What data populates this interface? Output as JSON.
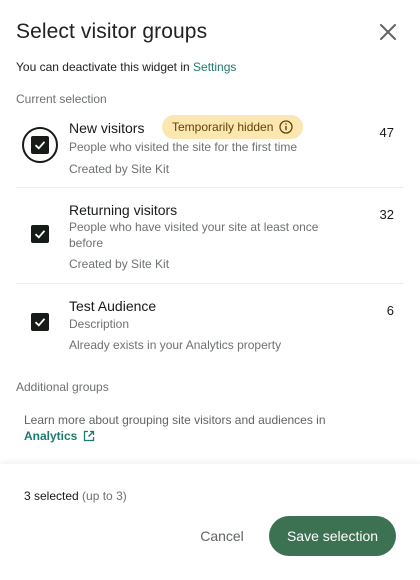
{
  "dialog": {
    "title": "Select visitor groups",
    "subtitle_text": "You can deactivate this widget in",
    "settings_link": "Settings"
  },
  "sections": {
    "current": "Current selection",
    "additional": "Additional groups"
  },
  "groups": [
    {
      "name": "New visitors",
      "badge": "Temporarily hidden",
      "description": "People who visited the site for the first time",
      "meta": "Created by Site Kit",
      "count": "47",
      "checked": true
    },
    {
      "name": "Returning visitors",
      "description": "People who have visited your site at least once before",
      "meta": "Created by Site Kit",
      "count": "32",
      "checked": true
    },
    {
      "name": "Test Audience",
      "description": "Description",
      "meta": "Already exists in your Analytics property",
      "count": "6",
      "checked": true
    }
  ],
  "learn_more": {
    "text": "Learn more about grouping site visitors and audiences in",
    "link": "Analytics"
  },
  "footer": {
    "selected": "3 selected",
    "limit": "(up to 3)",
    "cancel": "Cancel",
    "save": "Save selection"
  },
  "colors": {
    "accent": "#3c7251",
    "link": "#1f7a6e",
    "badge_bg": "#fce7b2"
  },
  "icons": {
    "close": "close-icon",
    "info": "info-icon",
    "external": "external-link-icon",
    "check": "checkmark-icon"
  }
}
